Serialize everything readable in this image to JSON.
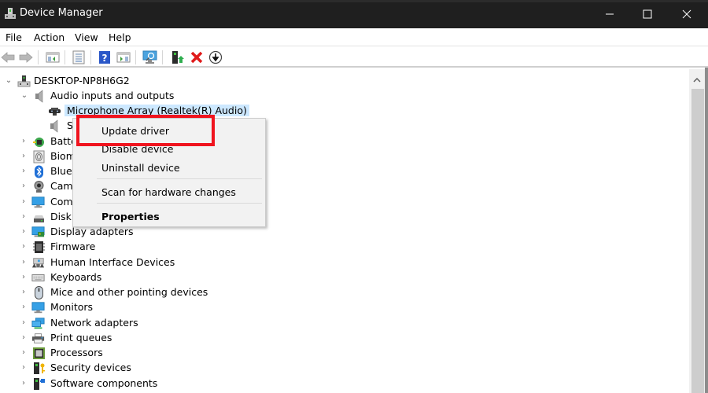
{
  "window": {
    "title": "Device Manager",
    "controls": {
      "minimize": "minimize",
      "maximize": "maximize",
      "close": "close"
    }
  },
  "menubar": {
    "items": [
      {
        "label": "File"
      },
      {
        "label": "Action"
      },
      {
        "label": "View"
      },
      {
        "label": "Help"
      }
    ]
  },
  "toolbar": {
    "buttons": [
      {
        "icon": "back-arrow-icon",
        "tooltip": "Back"
      },
      {
        "icon": "forward-arrow-icon",
        "tooltip": "Forward"
      },
      {
        "icon": "show-hide-console-tree-icon",
        "tooltip": "Show/Hide Console Tree"
      },
      {
        "icon": "properties-icon",
        "tooltip": "Properties"
      },
      {
        "icon": "help-icon",
        "tooltip": "Help"
      },
      {
        "icon": "show-action-pane-icon",
        "tooltip": "Show Action Pane"
      },
      {
        "icon": "scan-hardware-icon",
        "tooltip": "Scan for hardware changes"
      },
      {
        "icon": "update-driver-icon",
        "tooltip": "Update driver"
      },
      {
        "icon": "uninstall-device-icon",
        "tooltip": "Uninstall device"
      },
      {
        "icon": "disable-device-icon",
        "tooltip": "Disable device"
      }
    ]
  },
  "tree": {
    "root": {
      "label": "DESKTOP-NP8H6G2",
      "expanded": true
    },
    "items": [
      {
        "label": "Audio inputs and outputs",
        "expanded": true,
        "level": 1
      },
      {
        "label": "Microphone Array (Realtek(R) Audio)",
        "level": 2,
        "selected": true
      },
      {
        "label": "S",
        "level": 2
      },
      {
        "label": "Batte",
        "level": 1
      },
      {
        "label": "Biom",
        "level": 1
      },
      {
        "label": "Bluet",
        "level": 1
      },
      {
        "label": "Came",
        "level": 1
      },
      {
        "label": "Comp",
        "level": 1
      },
      {
        "label": "Disk d",
        "level": 1
      },
      {
        "label": "Display adapters",
        "level": 1
      },
      {
        "label": "Firmware",
        "level": 1
      },
      {
        "label": "Human Interface Devices",
        "level": 1
      },
      {
        "label": "Keyboards",
        "level": 1
      },
      {
        "label": "Mice and other pointing devices",
        "level": 1
      },
      {
        "label": "Monitors",
        "level": 1
      },
      {
        "label": "Network adapters",
        "level": 1
      },
      {
        "label": "Print queues",
        "level": 1
      },
      {
        "label": "Processors",
        "level": 1
      },
      {
        "label": "Security devices",
        "level": 1
      },
      {
        "label": "Software components",
        "level": 1
      }
    ]
  },
  "context_menu": {
    "items": [
      {
        "label": "Update driver",
        "highlighted": true
      },
      {
        "label": "Disable device"
      },
      {
        "label": "Uninstall device"
      },
      {
        "label": "Scan for hardware changes"
      },
      {
        "label": "Properties",
        "bold": true
      }
    ]
  },
  "colors": {
    "titlebar": "#1f1f1f",
    "selection": "#cce8ff",
    "highlight_box": "#f0141e",
    "menu_bg": "#f2f2f2"
  }
}
